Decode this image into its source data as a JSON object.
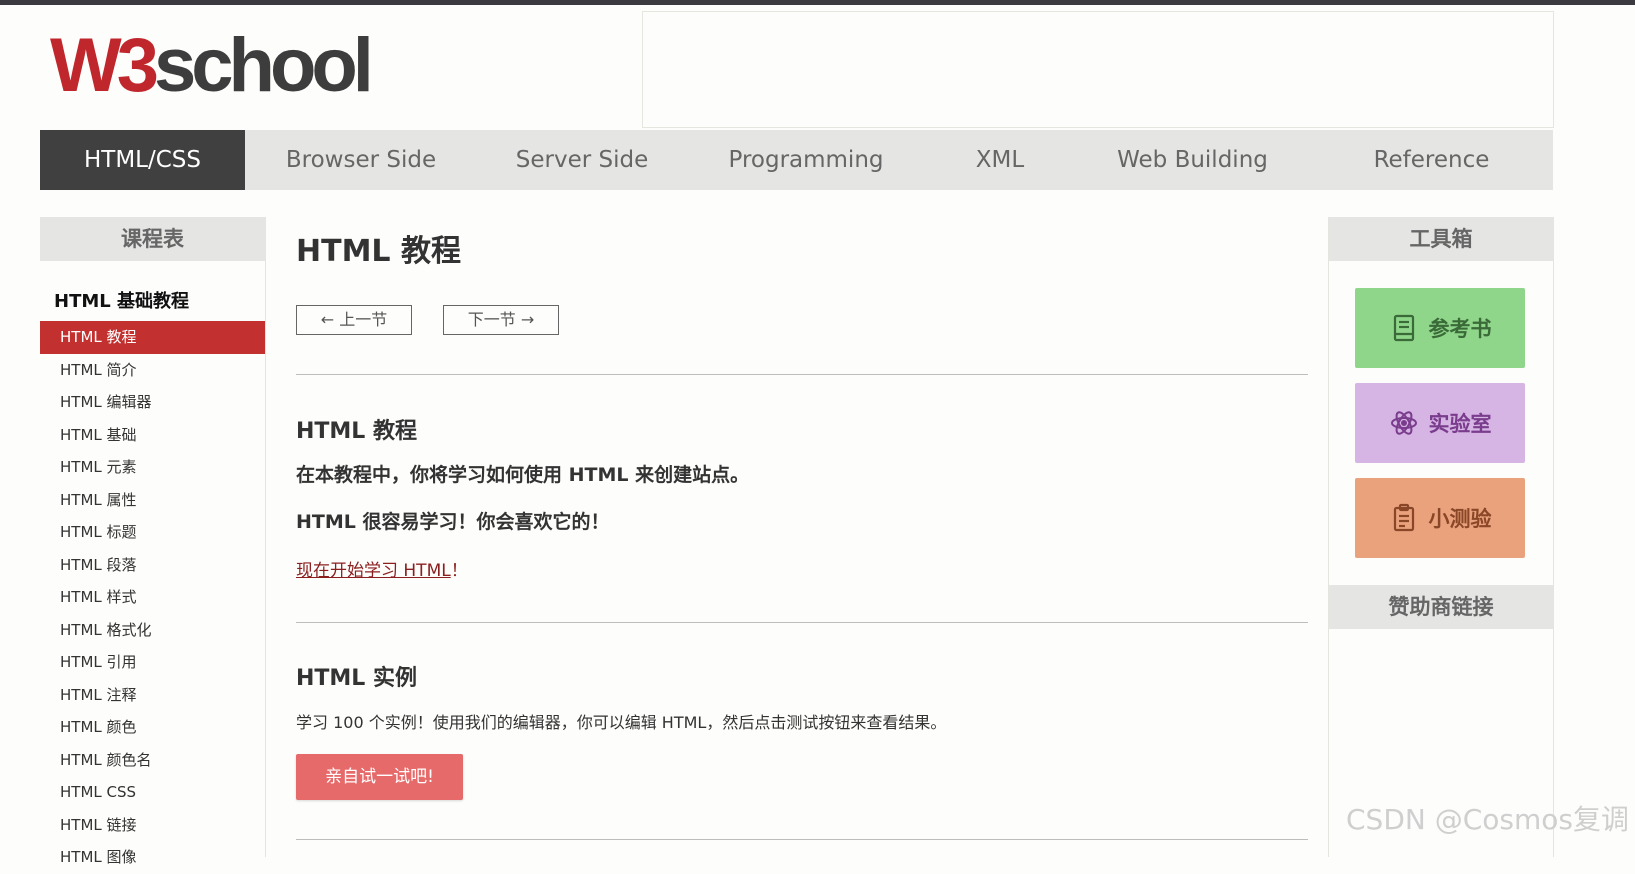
{
  "logo": {
    "w3": "W3",
    "school": "school"
  },
  "nav": {
    "items": [
      {
        "label": "HTML/CSS"
      },
      {
        "label": "Browser Side"
      },
      {
        "label": "Server Side"
      },
      {
        "label": "Programming"
      },
      {
        "label": "XML"
      },
      {
        "label": "Web Building"
      },
      {
        "label": "Reference"
      }
    ]
  },
  "sidebar": {
    "header": "课程表",
    "section_title": "HTML 基础教程",
    "items": [
      "HTML 教程",
      "HTML 简介",
      "HTML 编辑器",
      "HTML 基础",
      "HTML 元素",
      "HTML 属性",
      "HTML 标题",
      "HTML 段落",
      "HTML 样式",
      "HTML 格式化",
      "HTML 引用",
      "HTML 注释",
      "HTML 颜色",
      "HTML 颜色名",
      "HTML CSS",
      "HTML 链接",
      "HTML 图像"
    ]
  },
  "main": {
    "title": "HTML 教程",
    "prev_label": "← 上一节",
    "next_label": "下一节 →",
    "section1": {
      "heading": "HTML 教程",
      "line1": "在本教程中，你将学习如何使用 HTML 来创建站点。",
      "line2": "HTML 很容易学习！你会喜欢它的！",
      "link_text": "现在开始学习 HTML",
      "link_suffix": "！"
    },
    "section2": {
      "heading": "HTML 实例",
      "text": "学习 100 个实例！使用我们的编辑器，你可以编辑 HTML，然后点击测试按钮来查看结果。",
      "button": "亲自试一试吧!"
    }
  },
  "toolbox": {
    "header": "工具箱",
    "reference": "参考书",
    "lab": "实验室",
    "quiz": "小测验",
    "sponsor_header": "赞助商链接"
  },
  "watermark": "CSDN @Cosmos复调"
}
